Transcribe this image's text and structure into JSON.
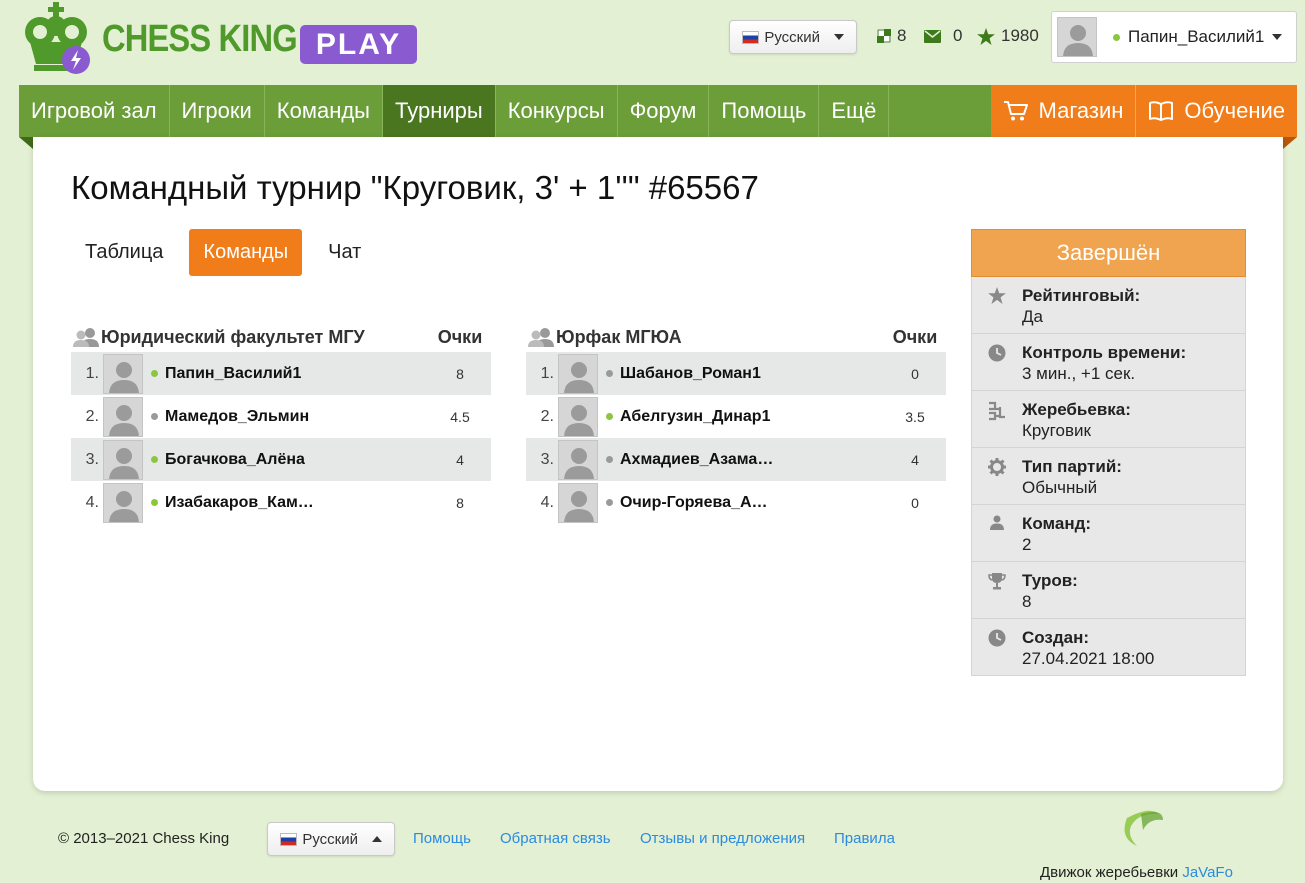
{
  "header": {
    "logo_text": "CHESS KING",
    "logo_play": "PLAY",
    "language": "Русский",
    "stat_games": "8",
    "stat_mail": "0",
    "stat_rating": "1980",
    "user_name": "Папин_Василий1"
  },
  "nav": {
    "items": [
      "Игровой зал",
      "Игроки",
      "Команды",
      "Турниры",
      "Конкурсы",
      "Форум",
      "Помощь",
      "Ещё"
    ],
    "active": "Турниры",
    "shop": "Магазин",
    "learn": "Обучение"
  },
  "page": {
    "title": "Командный турнир \"Круговик, 3' + 1''\" #65567",
    "tabs": [
      "Таблица",
      "Команды",
      "Чат"
    ],
    "active_tab": "Команды"
  },
  "teams": [
    {
      "name": "Юридический факультет МГУ",
      "points_label": "Очки",
      "players": [
        {
          "rank": "1.",
          "name": "Папин_Василий1",
          "score": "8",
          "online": true
        },
        {
          "rank": "2.",
          "name": "Мамедов_Эльмин",
          "score": "4.5",
          "online": false
        },
        {
          "rank": "3.",
          "name": "Богачкова_Алёна",
          "score": "4",
          "online": true
        },
        {
          "rank": "4.",
          "name": "Изабакаров_Кам…",
          "score": "8",
          "online": true
        }
      ]
    },
    {
      "name": "Юрфак МГЮА",
      "points_label": "Очки",
      "players": [
        {
          "rank": "1.",
          "name": "Шабанов_Роман1",
          "score": "0",
          "online": false
        },
        {
          "rank": "2.",
          "name": "Абелгузин_Динар1",
          "score": "3.5",
          "online": true
        },
        {
          "rank": "3.",
          "name": "Ахмадиев_Азама…",
          "score": "4",
          "online": false
        },
        {
          "rank": "4.",
          "name": "Очир-Горяева_А…",
          "score": "0",
          "online": false
        }
      ]
    }
  ],
  "info": {
    "status": "Завершён",
    "rows": [
      {
        "icon": "star-icon",
        "label": "Рейтинговый:",
        "value": "Да"
      },
      {
        "icon": "clock-icon",
        "label": "Контроль времени:",
        "value": "3 мин., +1 сек."
      },
      {
        "icon": "bracket-icon",
        "label": "Жеребьевка:",
        "value": "Круговик"
      },
      {
        "icon": "gear-icon",
        "label": "Тип партий:",
        "value": "Обычный"
      },
      {
        "icon": "person-icon",
        "label": "Команд:",
        "value": "2"
      },
      {
        "icon": "trophy-icon",
        "label": "Туров:",
        "value": "8"
      },
      {
        "icon": "clock-icon",
        "label": "Создан:",
        "value": "27.04.2021 18:00"
      }
    ]
  },
  "footer": {
    "copyright": "© 2013–2021 Chess King",
    "language": "Русский",
    "links": [
      "Помощь",
      "Обратная связь",
      "Отзывы и предложения",
      "Правила"
    ],
    "engine_label": "Движок жеребьевки",
    "engine_link": "JaVaFo"
  },
  "colors": {
    "nav_green": "#6b9d39",
    "nav_active": "#4a7620",
    "accent_orange": "#f07d1a",
    "status_orange": "#f0a44f",
    "online": "#8cc63f",
    "link": "#2a8be0"
  }
}
